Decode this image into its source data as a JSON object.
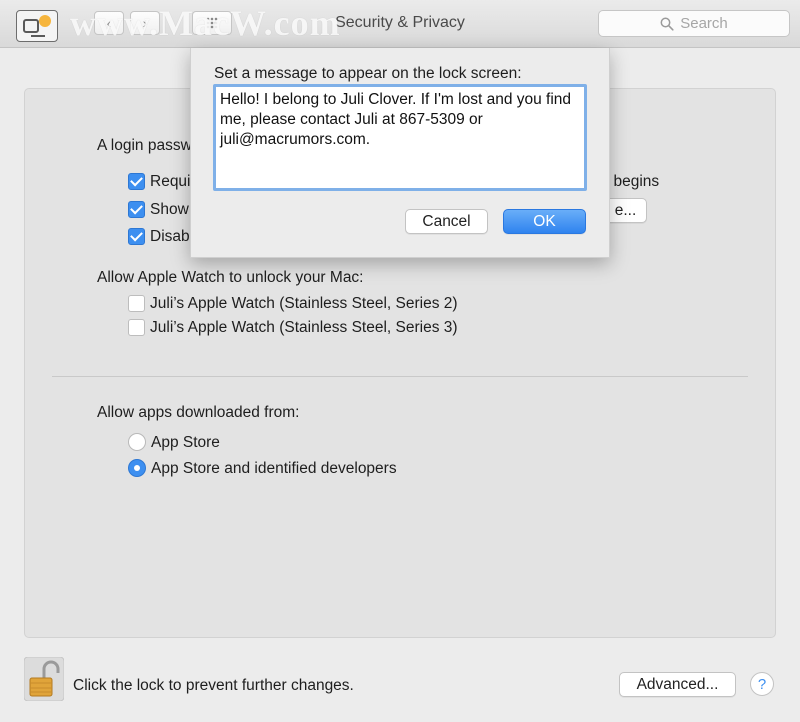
{
  "window": {
    "title": "Security & Privacy",
    "watermark": "www.MacW.com"
  },
  "toolbar": {
    "back_icon": "chevron-left-icon",
    "forward_icon": "chevron-right-icon",
    "grid_icon": "grid-icon",
    "search": {
      "placeholder": "Search",
      "icon": "search-icon"
    }
  },
  "general": {
    "login_password_label": "A login passw",
    "options": [
      {
        "label": "Requi",
        "checked": true
      },
      {
        "label": "Show",
        "checked": true
      },
      {
        "label": "Disab",
        "checked": true
      }
    ],
    "partial_text_right": "r begins",
    "partial_button_label": "e..."
  },
  "apple_watch": {
    "heading": "Allow Apple Watch to unlock your Mac:",
    "devices": [
      {
        "label": "Juli’s Apple Watch (Stainless Steel, Series 2)",
        "checked": false
      },
      {
        "label": "Juli’s Apple Watch (Stainless Steel, Series 3)",
        "checked": false
      }
    ]
  },
  "downloads": {
    "heading": "Allow apps downloaded from:",
    "options": [
      {
        "label": "App Store",
        "selected": false
      },
      {
        "label": "App Store and identified developers",
        "selected": true
      }
    ]
  },
  "sheet": {
    "prompt": "Set a message to appear on the lock screen:",
    "message": "Hello! I belong to Juli Clover. If I'm lost and you find me, please contact Juli at 867-5309 or juli@macrumors.com.",
    "cancel_label": "Cancel",
    "ok_label": "OK"
  },
  "footer": {
    "lock_text": "Click the lock to prevent further changes.",
    "advanced_label": "Advanced...",
    "help_label": "?"
  },
  "colors": {
    "accent": "#3d8ff0",
    "focus_ring": "#7fb0e8",
    "lock_gold": "#e0a43a"
  }
}
